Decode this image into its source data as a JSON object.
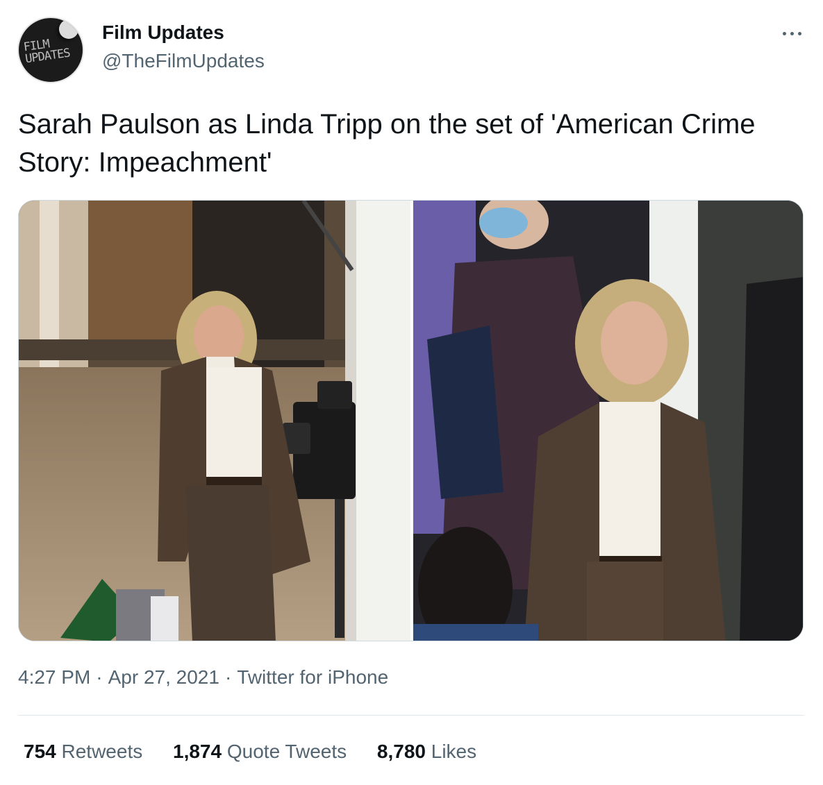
{
  "author": {
    "display_name": "Film Updates",
    "handle": "@TheFilmUpdates",
    "avatar_text_line1": "FILM",
    "avatar_text_line2": "UPDATES"
  },
  "tweet": {
    "text": "Sarah Paulson as Linda Tripp on the set of 'American Crime Story: Impeachment'",
    "media_count": 2,
    "time": "4:27 PM",
    "date": "Apr 27, 2021",
    "separator": "·",
    "source": "Twitter for iPhone"
  },
  "stats": {
    "retweets_count": "754",
    "retweets_label": "Retweets",
    "quote_tweets_count": "1,874",
    "quote_tweets_label": "Quote Tweets",
    "likes_count": "8,780",
    "likes_label": "Likes"
  },
  "icons": {
    "more": "more-horizontal-icon"
  },
  "colors": {
    "text_primary": "#0f1419",
    "text_secondary": "#536471",
    "border": "#cfd9de"
  }
}
